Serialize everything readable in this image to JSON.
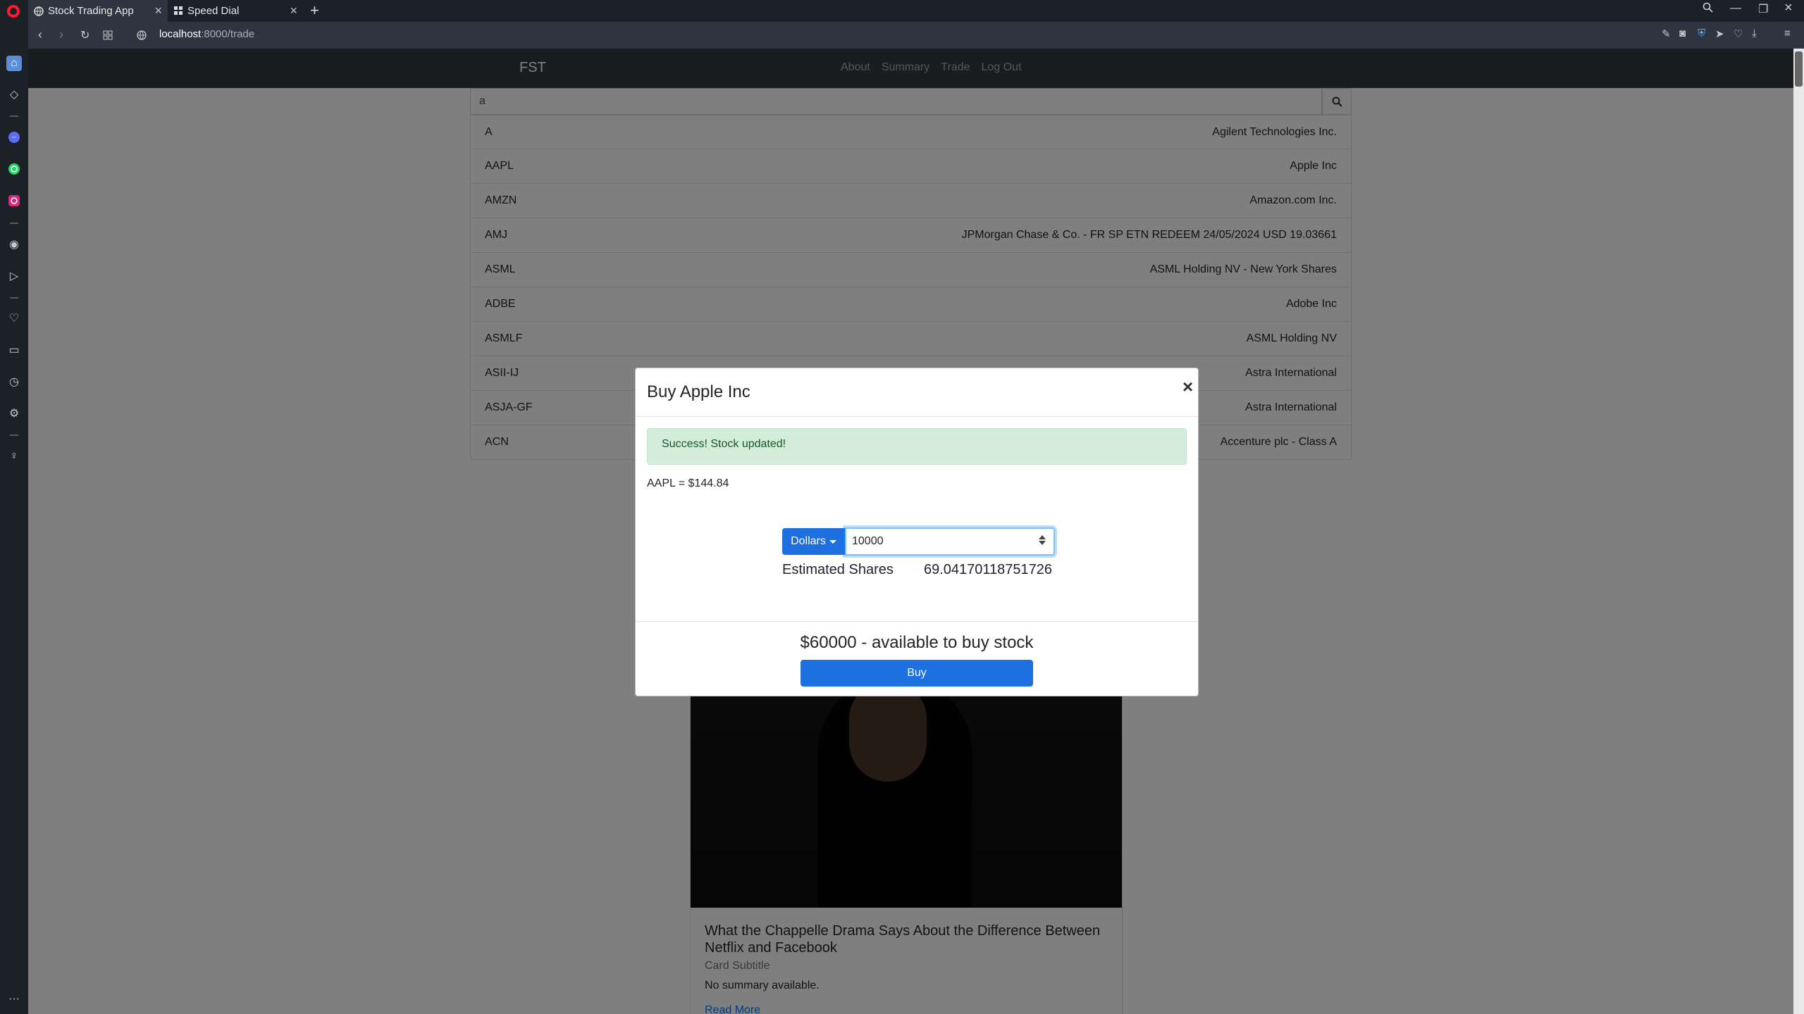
{
  "browser": {
    "tabs": [
      {
        "label": "Stock Trading App",
        "active": true
      },
      {
        "label": "Speed Dial",
        "active": false
      }
    ],
    "url_host": "localhost",
    "url_path": ":8000/trade"
  },
  "navbar": {
    "brand": "FST",
    "links": [
      "About",
      "Summary",
      "Trade",
      "Log Out"
    ]
  },
  "search": {
    "value": "a"
  },
  "results": [
    {
      "symbol": "A",
      "name": "Agilent Technologies Inc."
    },
    {
      "symbol": "AAPL",
      "name": "Apple Inc"
    },
    {
      "symbol": "AMZN",
      "name": "Amazon.com Inc."
    },
    {
      "symbol": "AMJ",
      "name": "JPMorgan Chase & Co. - FR SP ETN REDEEM 24/05/2024 USD 19.03661"
    },
    {
      "symbol": "ASML",
      "name": "ASML Holding NV - New York Shares"
    },
    {
      "symbol": "ADBE",
      "name": "Adobe Inc"
    },
    {
      "symbol": "ASMLF",
      "name": "ASML Holding NV"
    },
    {
      "symbol": "ASII-IJ",
      "name": "Astra International"
    },
    {
      "symbol": "ASJA-GF",
      "name": "Astra International"
    },
    {
      "symbol": "ACN",
      "name": "Accenture plc - Class A"
    }
  ],
  "news_card": {
    "title": "What the Chappelle Drama Says About the Difference Between Netflix and Facebook",
    "subtitle": "Card Subtitle",
    "text": "No summary available.",
    "link": "Read More"
  },
  "modal": {
    "title": "Buy Apple Inc",
    "close": "×",
    "alert": "Success! Stock updated!",
    "quote": "AAPL = $144.84",
    "mode_label": "Dollars",
    "amount": "10000",
    "estimated_label": "Estimated Shares",
    "estimated_value": "69.04170118751726",
    "available": "$60000 - available to buy stock",
    "buy_label": "Buy"
  },
  "colors": {
    "primary": "#1e6fe0",
    "success_bg": "#d4edda",
    "success_text": "#155724",
    "navbar_bg": "#343a40"
  }
}
